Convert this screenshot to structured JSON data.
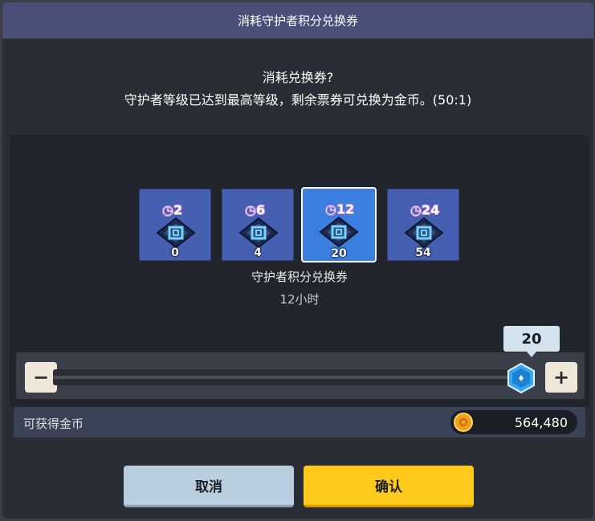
{
  "dialog": {
    "title": "消耗守护者积分兑换券",
    "question": "消耗兑换券?",
    "description": "守护者等级已达到最高等级，剩余票券可兑换为金币。(50:1)"
  },
  "tickets": [
    {
      "duration_badge": "2",
      "count": "0",
      "selected": false
    },
    {
      "duration_badge": "6",
      "count": "4",
      "selected": false
    },
    {
      "duration_badge": "12",
      "count": "20",
      "selected": true
    },
    {
      "duration_badge": "24",
      "count": "54",
      "selected": false
    }
  ],
  "selected_ticket": {
    "name": "守护者积分兑换券",
    "duration": "12小时"
  },
  "slider": {
    "value": "20",
    "max": 20,
    "minus_label": "−",
    "plus_label": "+"
  },
  "gold": {
    "label": "可获得金币",
    "value": "564,480",
    "icon": "coin-icon"
  },
  "buttons": {
    "cancel": "取消",
    "confirm": "确认"
  },
  "colors": {
    "title_bar": "#4a4f78",
    "ticket_bg": "#4560b0",
    "ticket_selected": "#3b7fe0",
    "confirm": "#ffca1c",
    "cancel": "#b9cfdf",
    "thumb": "#3aa6f0"
  }
}
